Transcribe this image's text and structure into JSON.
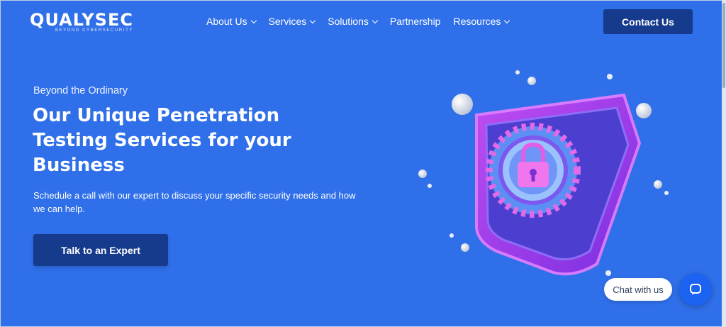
{
  "brand": {
    "name": "QUALYSEC",
    "tagline": "BEYOND CYBERSECURITY"
  },
  "nav": [
    {
      "label": "About Us",
      "has_dropdown": true
    },
    {
      "label": "Services",
      "has_dropdown": true
    },
    {
      "label": "Solutions",
      "has_dropdown": true
    },
    {
      "label": "Partnership",
      "has_dropdown": false
    },
    {
      "label": "Resources",
      "has_dropdown": true
    }
  ],
  "header": {
    "contact_label": "Contact Us"
  },
  "hero": {
    "eyebrow": "Beyond the Ordinary",
    "title": "Our Unique Penetration Testing Services for your Business",
    "subtitle": "Schedule a call with our expert to discuss your specific security needs and how we can help.",
    "cta_label": "Talk to an Expert",
    "illustration_icon": "shield-lock-icon"
  },
  "chat": {
    "label": "Chat with us",
    "icon": "chat-icon"
  },
  "colors": {
    "background": "#2f6fe9",
    "button": "#163a8c",
    "shield": "#a23cf0"
  }
}
